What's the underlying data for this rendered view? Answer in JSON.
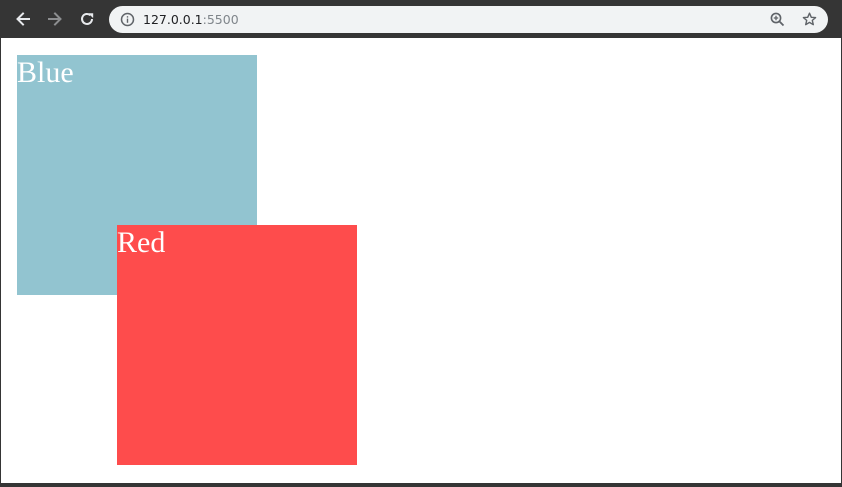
{
  "browser": {
    "back_icon": "arrow-left-icon",
    "forward_icon": "arrow-right-icon",
    "reload_icon": "reload-icon",
    "info_icon": "info-icon",
    "zoom_icon": "zoom-icon",
    "bookmark_icon": "star-icon",
    "address": {
      "host": "127.0.0.1",
      "port": ":5500"
    }
  },
  "page": {
    "boxes": [
      {
        "label": "Blue",
        "color": "#92c4d0"
      },
      {
        "label": "Red",
        "color": "#fe4c4c"
      }
    ]
  },
  "colors": {
    "toolbar": "#353535",
    "omnibox": "#f1f3f4",
    "page_background": "#ffffff"
  }
}
